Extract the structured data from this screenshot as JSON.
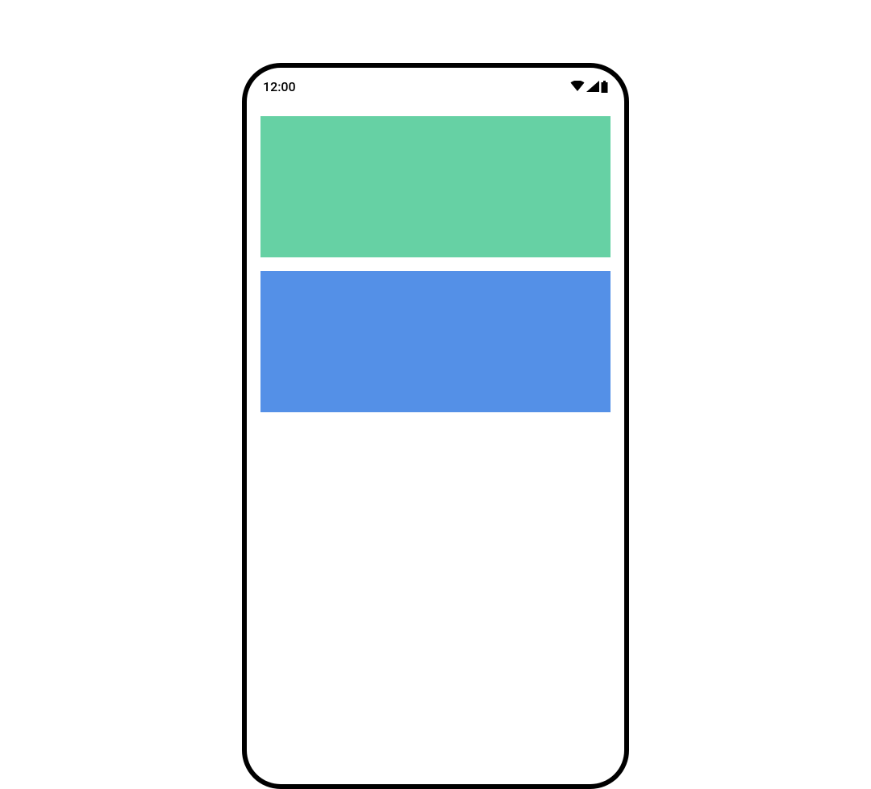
{
  "status_bar": {
    "time": "12:00"
  },
  "blocks": {
    "a": {
      "color": "#66d1a4"
    },
    "b": {
      "color": "#5490e7"
    }
  }
}
